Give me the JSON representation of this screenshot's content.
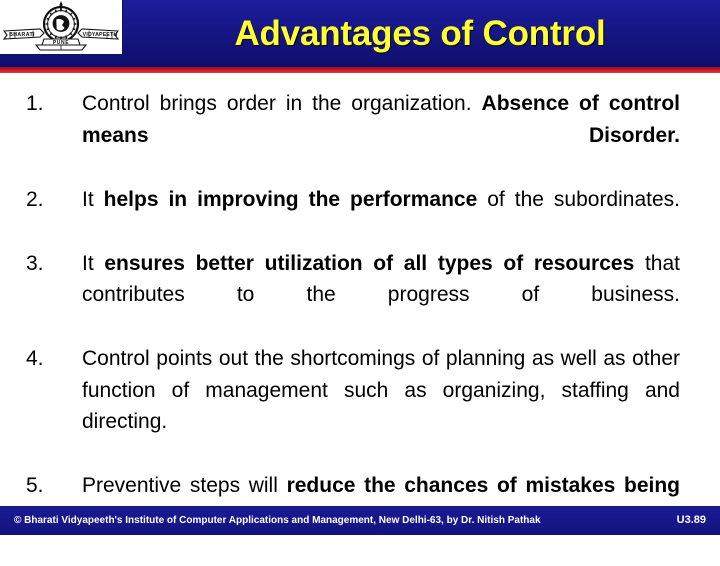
{
  "header": {
    "title": "Advantages of Control",
    "title_color": "#ffff33",
    "band_color": "#161689",
    "rule_color": "#c4182c",
    "logo": {
      "name": "bharati-vidyapeeth-emblem",
      "left_banner_text": "BHARATI",
      "right_banner_text": "VIDYAPEETH",
      "sub_text": "PUNE"
    }
  },
  "content": {
    "items": [
      {
        "number": "1.",
        "runs": [
          {
            "text": "Control brings order in the organization.  ",
            "bold": false
          },
          {
            "text": "Absence of control means Disorder.",
            "bold": true
          }
        ]
      },
      {
        "number": "2.",
        "runs": [
          {
            "text": "It ",
            "bold": false
          },
          {
            "text": "helps in improving the performance",
            "bold": true
          },
          {
            "text": " of the subordinates.",
            "bold": false
          }
        ]
      },
      {
        "number": "3.",
        "runs": [
          {
            "text": "It ",
            "bold": false
          },
          {
            "text": "ensures better utilization of all types of resources",
            "bold": true
          },
          {
            "text": " that contributes to the progress of business.",
            "bold": false
          }
        ]
      },
      {
        "number": "4.",
        "runs": [
          {
            "text": "Control points out the shortcomings of planning as well as other function of management such as organizing, staffing and directing.",
            "bold": false
          }
        ]
      },
      {
        "number": "5.",
        "runs": [
          {
            "text": "Preventive steps will ",
            "bold": false
          },
          {
            "text": "reduce the chances of mistakes being repeated in future.",
            "bold": true
          }
        ]
      }
    ]
  },
  "footer": {
    "credit": "© Bharati  Vidyapeeth's Institute of Computer Applications and Management, New Delhi-63, by Dr. Nitish Pathak",
    "slide_code": "U3.89",
    "band_color": "#161689"
  }
}
